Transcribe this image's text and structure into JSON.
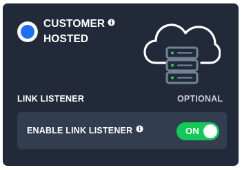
{
  "card": {
    "title_line1": "CUSTOMER",
    "title_line2": "HOSTED",
    "selected": true,
    "illustration": "cloud-server-icon"
  },
  "link_listener": {
    "section_label": "LINK LISTENER",
    "optional_label": "OPTIONAL",
    "enable_label": "ENABLE LINK LISTENER",
    "toggle_state": "ON",
    "enabled": true
  },
  "colors": {
    "card_background": "#222a3a",
    "row_background": "#323d50",
    "radio_accent": "#1f6ff2",
    "toggle_on": "#16c85a",
    "server_outline": "#6f8495",
    "led": "#22d16b"
  },
  "icons": [
    "info-icon",
    "cloud-server-icon"
  ]
}
